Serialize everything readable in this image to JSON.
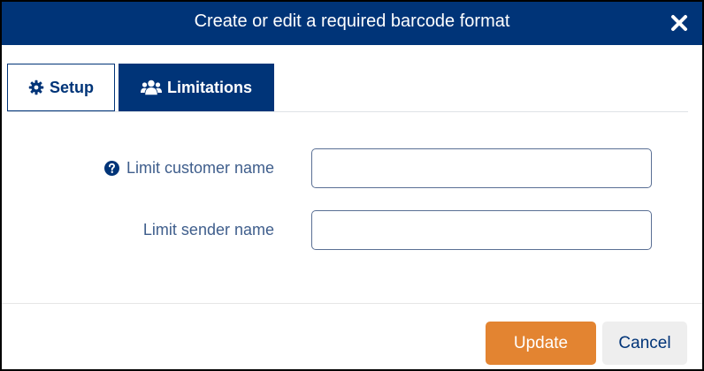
{
  "dialog": {
    "title": "Create or edit a required barcode format",
    "close_icon": "close-x-icon"
  },
  "tabs": [
    {
      "label": "Setup",
      "icon": "gear-icon",
      "active": false
    },
    {
      "label": "Limitations",
      "icon": "users-icon",
      "active": true
    }
  ],
  "form": {
    "customer_name": {
      "label": "Limit customer name",
      "value": "",
      "help_icon": "question-circle-icon"
    },
    "sender_name": {
      "label": "Limit sender name",
      "value": ""
    }
  },
  "footer": {
    "update_label": "Update",
    "cancel_label": "Cancel"
  },
  "colors": {
    "primary": "#003478",
    "accent": "#e38431",
    "label": "#3f5e8c"
  }
}
